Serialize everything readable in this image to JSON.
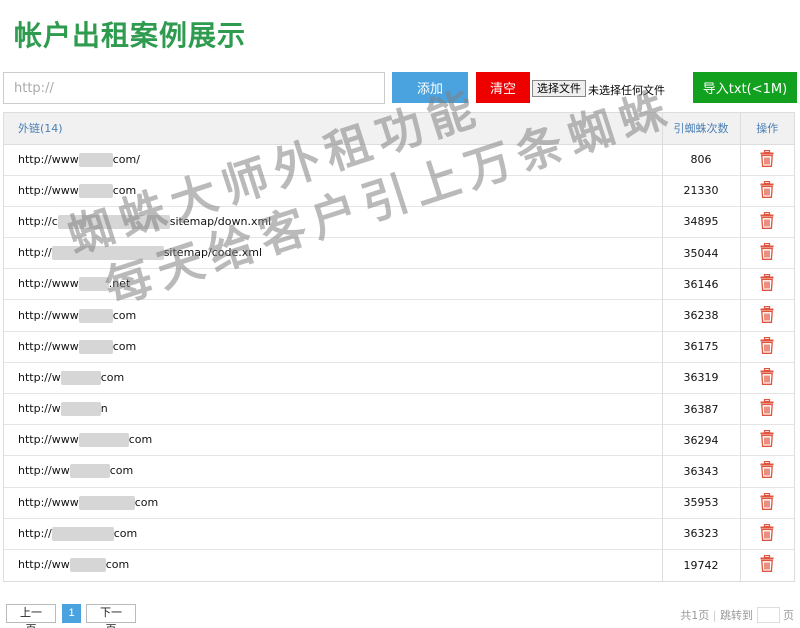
{
  "page": {
    "title": "帐户出租案例展示"
  },
  "toolbar": {
    "url_placeholder": "http://",
    "add_label": "添加",
    "clear_label": "清空",
    "file_choose_label": "选择文件",
    "file_status": "未选择任何文件",
    "import_label": "导入txt(<1M)"
  },
  "table": {
    "headers": {
      "link": "外链(14)",
      "count": "引蜘蛛次数",
      "op": "操作"
    },
    "rows": [
      {
        "link_prefix": "http://www",
        "link_suffix": "com/",
        "count": "806"
      },
      {
        "link_prefix": "http://www",
        "link_suffix": "com",
        "count": "21330"
      },
      {
        "link_prefix": "http://c",
        "link_suffix": "sitemap/down.xml",
        "count": "34895"
      },
      {
        "link_prefix": "http://",
        "link_suffix": "sitemap/code.xml",
        "count": "35044"
      },
      {
        "link_prefix": "http://www",
        "link_suffix": ".net",
        "count": "36146"
      },
      {
        "link_prefix": "http://www",
        "link_suffix": "com",
        "count": "36238"
      },
      {
        "link_prefix": "http://www",
        "link_suffix": "com",
        "count": "36175"
      },
      {
        "link_prefix": "http://w",
        "link_suffix": "com",
        "count": "36319"
      },
      {
        "link_prefix": "http://w",
        "link_suffix": "n",
        "count": "36387"
      },
      {
        "link_prefix": "http://www",
        "link_suffix": "com",
        "count": "36294"
      },
      {
        "link_prefix": "http://ww",
        "link_suffix": "com",
        "count": "36343"
      },
      {
        "link_prefix": "http://www",
        "link_suffix": "com",
        "count": "35953"
      },
      {
        "link_prefix": "http://",
        "link_suffix": "com",
        "count": "36323"
      },
      {
        "link_prefix": "http://ww",
        "link_suffix": "com",
        "count": "19742"
      }
    ]
  },
  "pager": {
    "prev_label": "上一页",
    "current": "1",
    "next_label": "下一页",
    "total_text": "共1页",
    "jump_text": "跳转到",
    "page_suffix": "页"
  },
  "watermark": {
    "line1": "蜘蛛大师外租功能",
    "line2": "每天给客户引上万条蜘蛛"
  },
  "colors": {
    "title": "#2e9b4f",
    "add": "#4aa3df",
    "clear": "#ee0000",
    "import": "#12a11f",
    "trash": "#e0533d"
  },
  "icons": {
    "row_action": "trash-icon"
  }
}
